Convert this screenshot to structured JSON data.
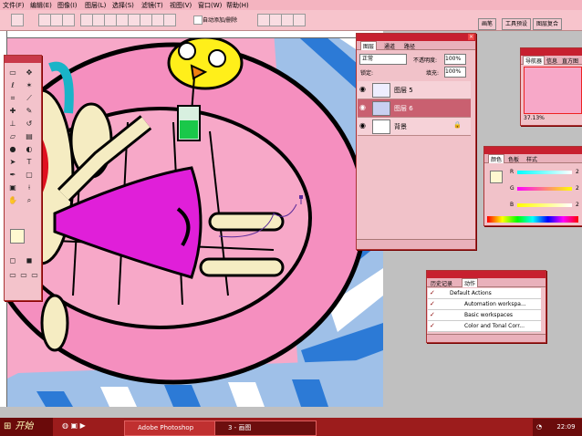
{
  "menu": {
    "items": [
      "文件(F)",
      "编辑(E)",
      "图像(I)",
      "图层(L)",
      "选择(S)",
      "滤镜(T)",
      "视图(V)",
      "窗口(W)",
      "帮助(H)"
    ]
  },
  "options": {
    "auto_add_delete": "自动添加/删除"
  },
  "workspace_tabs": [
    "画笔",
    "工具预设",
    "图层复合"
  ],
  "layers_panel": {
    "tabs": [
      "图层",
      "通道",
      "路径"
    ],
    "blend_mode": "正常",
    "opacity_label": "不透明度:",
    "opacity_value": "100%",
    "lock_label": "锁定:",
    "fill_label": "填充:",
    "fill_value": "100%",
    "layers": [
      {
        "name": "图层 5",
        "selected": false
      },
      {
        "name": "图层 6",
        "selected": true
      },
      {
        "name": "背景",
        "selected": false
      }
    ]
  },
  "navigator": {
    "tabs": [
      "导航器",
      "信息",
      "直方图"
    ],
    "zoom": "37.13%"
  },
  "color_panel": {
    "tabs": [
      "颜色",
      "色板",
      "样式"
    ],
    "r_label": "R",
    "g_label": "G",
    "b_label": "B",
    "r_value": "2",
    "g_value": "2",
    "b_value": "2"
  },
  "actions_panel": {
    "tabs": [
      "历史记录",
      "动作"
    ],
    "items": [
      "Default Actions",
      "Automation workspa...",
      "Basic workspaces",
      "Color and Tonal Corr..."
    ]
  },
  "taskbar": {
    "start_label": "开始",
    "buttons": [
      {
        "label": "Adobe Photoshop",
        "active": false
      },
      {
        "label": "3 - 画图",
        "active": true
      }
    ],
    "clock": "22:09"
  },
  "colors": {
    "canvas_pink": "#f7a8c8",
    "panel_header": "#c7202f",
    "selected_layer": "#c96070",
    "taskbar": "#9c1c1c"
  }
}
